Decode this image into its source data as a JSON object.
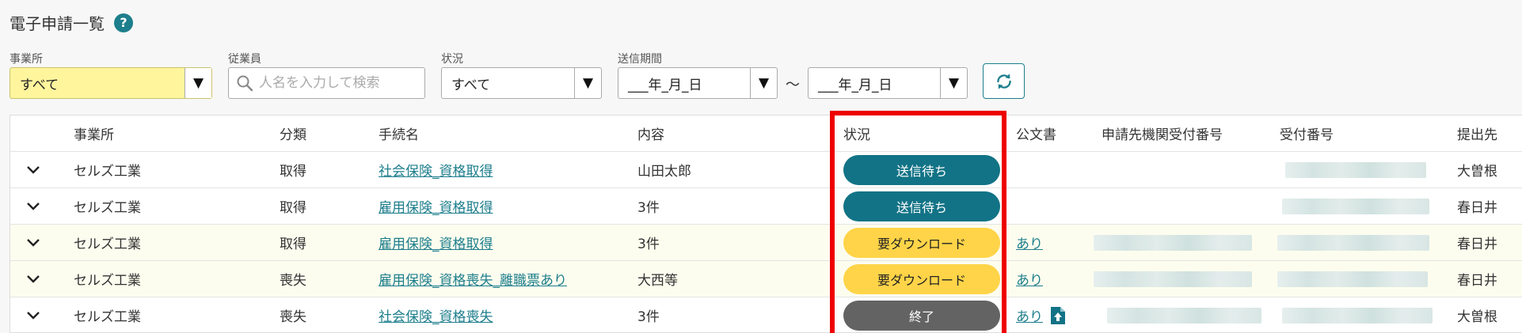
{
  "page": {
    "title": "電子申請一覧",
    "help_icon_text": "?"
  },
  "filters": {
    "office": {
      "label": "事業所",
      "value": "すべて"
    },
    "employee": {
      "label": "従業員",
      "placeholder": "人名を入力して検索"
    },
    "status": {
      "label": "状況",
      "value": "すべて"
    },
    "period": {
      "label": "送信期間",
      "from": "___年_月_日",
      "to": "___年_月_日",
      "separator": "～"
    }
  },
  "table": {
    "headers": {
      "office": "事業所",
      "category": "分類",
      "procedure": "手続名",
      "content": "内容",
      "status": "状況",
      "document": "公文書",
      "agency_number": "申請先機関受付番号",
      "receipt_number": "受付番号",
      "submit_to": "提出先"
    },
    "rows": [
      {
        "office": "セルズ工業",
        "category": "取得",
        "procedure": "社会保険_資格取得",
        "content": "山田太郎",
        "status": "送信待ち",
        "document": "",
        "submit_to": "大曽根"
      },
      {
        "office": "セルズ工業",
        "category": "取得",
        "procedure": "雇用保険_資格取得",
        "content": "3件",
        "status": "送信待ち",
        "document": "",
        "submit_to": "春日井"
      },
      {
        "office": "セルズ工業",
        "category": "取得",
        "procedure": "雇用保険_資格取得",
        "content": "3件",
        "status": "要ダウンロード",
        "document": "あり",
        "submit_to": "春日井"
      },
      {
        "office": "セルズ工業",
        "category": "喪失",
        "procedure": "雇用保険_資格喪失_離職票あり",
        "content": "大西等",
        "status": "要ダウンロード",
        "document": "あり",
        "submit_to": "春日井"
      },
      {
        "office": "セルズ工業",
        "category": "喪失",
        "procedure": "社会保険_資格喪失",
        "content": "3件",
        "status": "終了",
        "document": "あり",
        "submit_to": "大曽根"
      }
    ]
  },
  "colors": {
    "accent": "#1d7e8c",
    "status_waiting": "#127386",
    "status_download": "#ffd448",
    "status_done": "#636363",
    "highlight": "#ee0000",
    "office_select_bg": "#fff59d"
  }
}
